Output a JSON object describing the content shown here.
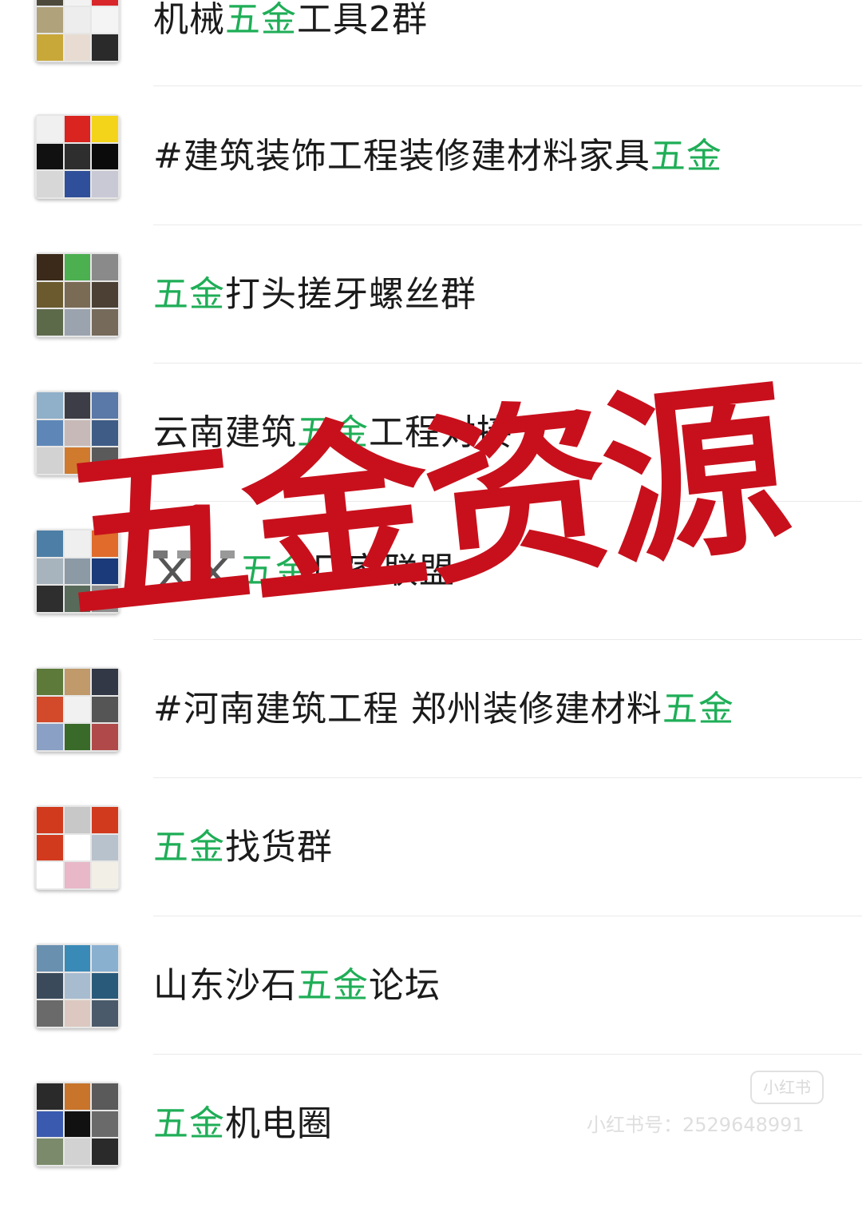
{
  "groups": [
    {
      "pre": "机械",
      "hl": "五金",
      "post": "工具2群",
      "tools": false,
      "avatar": [
        "#4d4a3c",
        "#f2f2f2",
        "#d8262b",
        "#b0a27a",
        "#ededed",
        "#f4f4f4",
        "#c9a83a",
        "#e8dcd2",
        "#2a2a2a"
      ]
    },
    {
      "pre": "#建筑装饰工程装修建材料家具",
      "hl": "五金",
      "post": "",
      "tools": false,
      "avatar": [
        "#f0f0f0",
        "#d9241f",
        "#f3d41a",
        "#111111",
        "#2e2e2e",
        "#0b0b0b",
        "#d7d7d7",
        "#2f4f9a",
        "#c9c9d6"
      ]
    },
    {
      "pre": "",
      "hl": "五金",
      "post": "打头搓牙螺丝群",
      "tools": false,
      "avatar": [
        "#3b2a1a",
        "#4caf50",
        "#8a8a8a",
        "#6a5a2e",
        "#7a6b55",
        "#4b4033",
        "#5c6a4a",
        "#9aa3ae",
        "#766a5a"
      ]
    },
    {
      "pre": "云南建筑",
      "hl": "五金",
      "post": "工程对接",
      "tools": false,
      "avatar": [
        "#8fb0c8",
        "#3c3d46",
        "#5a78a8",
        "#5e87b8",
        "#c7b9b7",
        "#3e5c86",
        "#d2d2d2",
        "#d07a2e",
        "#5a5a5a"
      ]
    },
    {
      "pre": "",
      "hl": "五金",
      "post": "厂家联盟",
      "tools": true,
      "avatar": [
        "#4d7fa6",
        "#efefef",
        "#e06b2a",
        "#a8b4bd",
        "#8c9aa6",
        "#1a3a7a",
        "#2e2e2e",
        "#586a5a",
        "#8e8e8e"
      ]
    },
    {
      "pre": "#河南建筑工程 郑州装修建材料",
      "hl": "五金",
      "post": "",
      "tools": false,
      "avatar": [
        "#5d7a3a",
        "#c09a6a",
        "#333846",
        "#d24a2a",
        "#f1f1f1",
        "#555555",
        "#8aa0c4",
        "#3a6a2a",
        "#b04a4a"
      ]
    },
    {
      "pre": "",
      "hl": "五金",
      "post": "找货群",
      "tools": false,
      "avatar": [
        "#d23a1e",
        "#c8c8c8",
        "#d23a1e",
        "#d23a1e",
        "#ffffff",
        "#b8c2cc",
        "#ffffff",
        "#e8b8c8",
        "#f2efe6"
      ]
    },
    {
      "pre": "山东沙石",
      "hl": "五金",
      "post": "论坛",
      "tools": false,
      "avatar": [
        "#6a90b0",
        "#3a8ab8",
        "#8ab0d0",
        "#3a4a5a",
        "#a8bcd0",
        "#2a5a7a",
        "#6a6a6a",
        "#dcc8c0",
        "#4a5a6a"
      ]
    },
    {
      "pre": "",
      "hl": "五金",
      "post": "机电圈",
      "tools": false,
      "avatar": [
        "#2a2a2a",
        "#c8742a",
        "#5a5a5a",
        "#3a5ab0",
        "#111111",
        "#6a6a6a",
        "#7a8a6a",
        "#d2d2d2",
        "#2a2a2a"
      ]
    }
  ],
  "stamp_text": "五金资源",
  "watermark": {
    "logo": "小红书",
    "text": "小红书号：2529648991"
  },
  "colors": {
    "highlight": "#1fae57",
    "stamp": "#c8101c",
    "text": "#1b1b1b"
  }
}
